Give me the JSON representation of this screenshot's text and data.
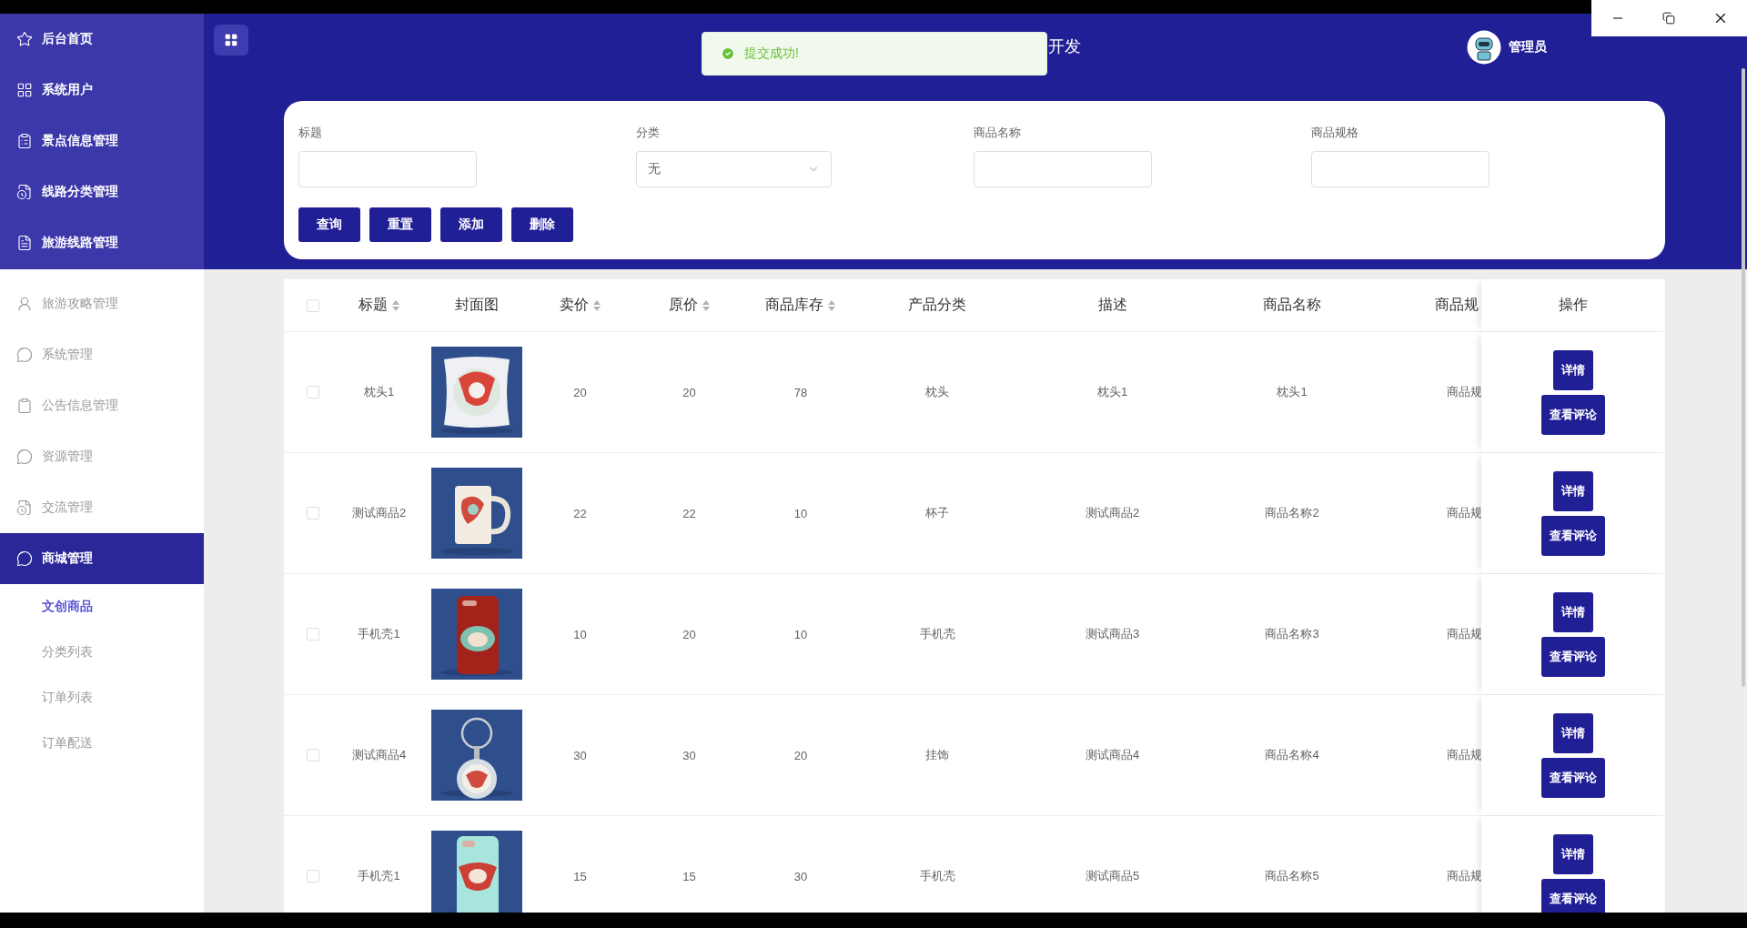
{
  "header": {
    "title": "开发",
    "user": {
      "name": "管理员"
    }
  },
  "toast": {
    "message": "提交成功!"
  },
  "sidebar": {
    "items": [
      {
        "label": "后台首页",
        "selected": false
      },
      {
        "label": "系统用户",
        "selected": false
      },
      {
        "label": "景点信息管理",
        "selected": false
      },
      {
        "label": "线路分类管理",
        "selected": false
      },
      {
        "label": "旅游线路管理",
        "selected": false
      },
      {
        "label": "旅游攻略管理",
        "selected": false
      },
      {
        "label": "系统管理",
        "selected": false
      },
      {
        "label": "公告信息管理",
        "selected": false
      },
      {
        "label": "资源管理",
        "selected": false
      },
      {
        "label": "交流管理",
        "selected": false
      },
      {
        "label": "商城管理",
        "selected": true,
        "children": [
          {
            "label": "文创商品",
            "selected": true
          },
          {
            "label": "分类列表",
            "selected": false
          },
          {
            "label": "订单列表",
            "selected": false
          },
          {
            "label": "订单配送",
            "selected": false
          }
        ]
      }
    ]
  },
  "filters": {
    "fields": [
      {
        "label": "标题",
        "kind": "text"
      },
      {
        "label": "分类",
        "kind": "select",
        "value": "无"
      },
      {
        "label": "商品名称",
        "kind": "text"
      },
      {
        "label": "商品规格",
        "kind": "text"
      }
    ],
    "buttons": [
      "查询",
      "重置",
      "添加",
      "删除"
    ]
  },
  "table": {
    "select_all": {
      "checked": false
    },
    "columns": [
      {
        "label": "标题",
        "kind": "text",
        "sortable": true
      },
      {
        "label": "封面图",
        "sortable": false
      },
      {
        "label": "卖价",
        "kind": "text",
        "sortable": true
      },
      {
        "label": "原价",
        "kind": "text",
        "sortable": true
      },
      {
        "label": "商品库存",
        "kind": "text",
        "sortable": true
      },
      {
        "label": "产品分类",
        "kind": "text",
        "sortable": false
      },
      {
        "label": "描述",
        "kind": "text",
        "sortable": false
      },
      {
        "label": "商品名称",
        "kind": "text",
        "sortable": false
      },
      {
        "label": "商品规",
        "kind": "text"
      },
      {
        "label": "操作",
        "kind": "actions",
        "sortable": false
      }
    ],
    "rows": [
      {
        "checked": false,
        "cells": [
          "枕头1",
          {
            "kind": "picture"
          },
          "20",
          "20",
          "78",
          "枕头",
          "枕头1",
          "枕头1",
          "商品规"
        ],
        "actions": [
          "详情",
          "查看评论"
        ]
      },
      {
        "checked": false,
        "cells": [
          "测试商品2",
          {
            "kind": "picture"
          },
          "22",
          "22",
          "10",
          "杯子",
          "测试商品2",
          "商品名称2",
          "商品规"
        ],
        "actions": [
          "详情",
          "查看评论"
        ]
      },
      {
        "checked": false,
        "cells": [
          "手机壳1",
          {
            "kind": "picture"
          },
          "10",
          "20",
          "10",
          "手机壳",
          "测试商品3",
          "商品名称3",
          "商品规"
        ],
        "actions": [
          "详情",
          "查看评论"
        ]
      },
      {
        "checked": false,
        "cells": [
          "测试商品4",
          {
            "kind": "picture"
          },
          "30",
          "30",
          "20",
          "挂饰",
          "测试商品4",
          "商品名称4",
          "商品规"
        ],
        "actions": [
          "详情",
          "查看评论"
        ]
      },
      {
        "checked": false,
        "cells": [
          "手机壳1",
          {
            "kind": "picture"
          },
          "15",
          "15",
          "30",
          "手机壳",
          "测试商品5",
          "商品名称5",
          "商品规"
        ],
        "actions": [
          "详情",
          "查看评论"
        ]
      }
    ]
  }
}
